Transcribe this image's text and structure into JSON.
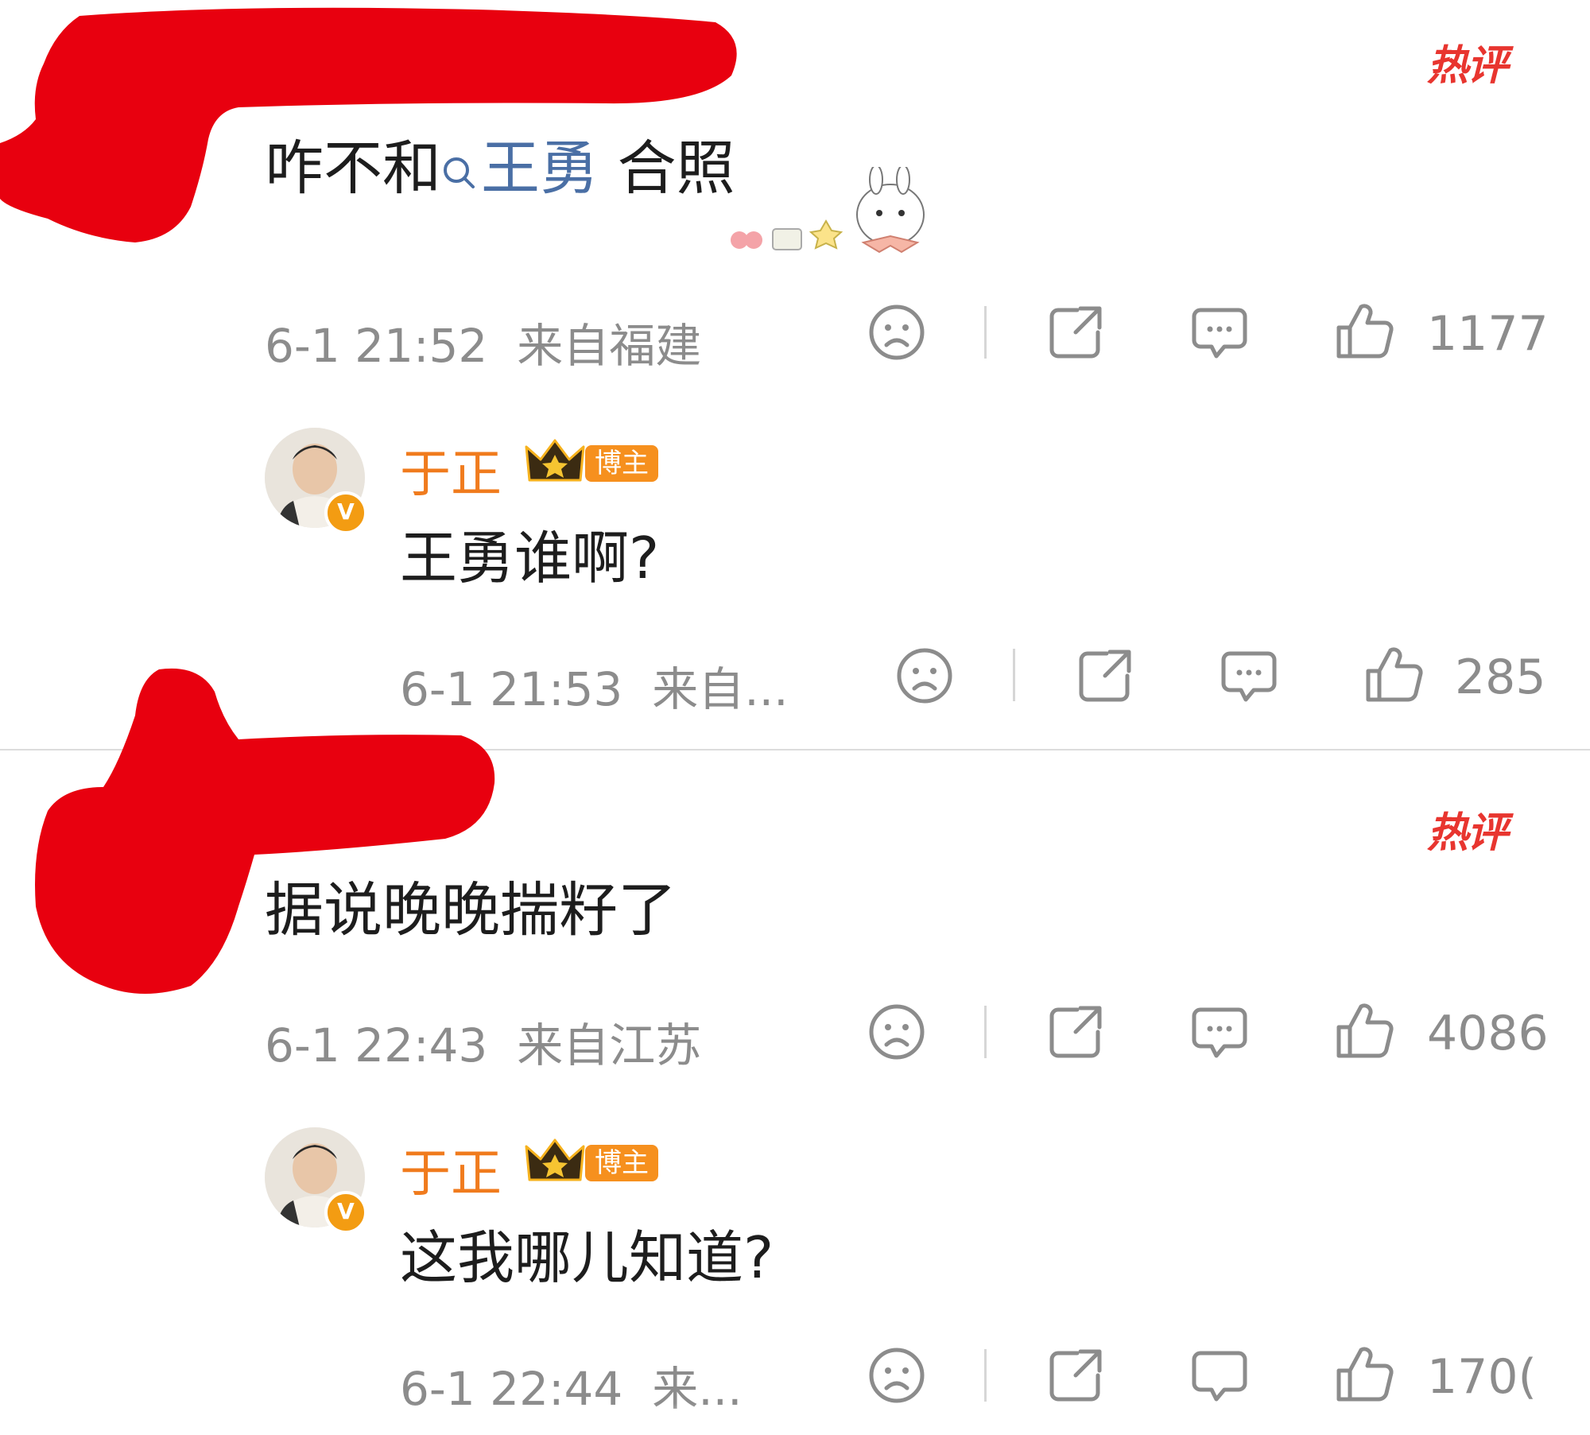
{
  "hot_badge_label": "热评",
  "threads": [
    {
      "comment": {
        "text_before": "咋不和",
        "mention": "王勇",
        "text_after": " 合照",
        "time": "6-1 21:52",
        "location": "来自福建",
        "likes": "1177"
      },
      "reply": {
        "author": "于正",
        "author_tag": "博主",
        "verified_mark": "V",
        "text": "王勇谁啊?",
        "time": "6-1 21:53",
        "location": "来自...",
        "likes": "285"
      }
    },
    {
      "comment": {
        "text": "据说晚晚揣籽了",
        "time": "6-1 22:43",
        "location": "来自江苏",
        "likes": "4086"
      },
      "reply": {
        "author": "于正",
        "author_tag": "博主",
        "verified_mark": "V",
        "text": "这我哪儿知道?",
        "time": "6-1 22:44",
        "location": "来...",
        "likes": "170("
      }
    }
  ],
  "colors": {
    "accent_hot": "#e8352f",
    "author_orange": "#f07b1d",
    "mention_blue": "#4a6fa5",
    "redaction": "#e8000f",
    "meta_gray": "#8c8c8c"
  },
  "icons": [
    "sad-face-icon",
    "share-icon",
    "comment-icon",
    "thumbs-up-icon",
    "search-icon",
    "crown-icon",
    "verified-icon"
  ]
}
